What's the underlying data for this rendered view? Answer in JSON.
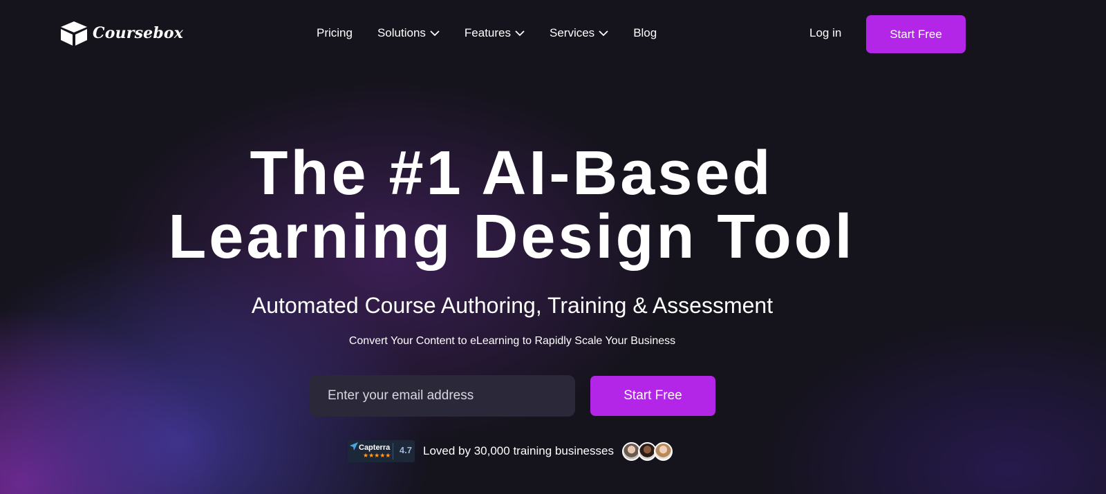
{
  "header": {
    "logo_text": "Coursebox",
    "nav": [
      {
        "label": "Pricing",
        "dropdown": false
      },
      {
        "label": "Solutions",
        "dropdown": true
      },
      {
        "label": "Features",
        "dropdown": true
      },
      {
        "label": "Services",
        "dropdown": true
      },
      {
        "label": "Blog",
        "dropdown": false
      }
    ],
    "login_label": "Log in",
    "cta_label": "Start Free"
  },
  "hero": {
    "title_line1": "The #1 AI-Based",
    "title_line2": "Learning Design Tool",
    "subtitle": "Automated Course Authoring, Training & Assessment",
    "tagline": "Convert Your Content to eLearning to Rapidly Scale Your Business",
    "email_placeholder": "Enter your email address",
    "cta_label": "Start Free"
  },
  "social_proof": {
    "badge_name": "Capterra",
    "badge_stars": "★★★★★",
    "badge_score": "4.7",
    "text": "Loved by 30,000 training businesses",
    "avatars": [
      "avatar-1",
      "avatar-2",
      "avatar-3"
    ]
  },
  "colors": {
    "accent": "#b326e8",
    "background": "#15131c",
    "input_bg": "#2b2839"
  }
}
